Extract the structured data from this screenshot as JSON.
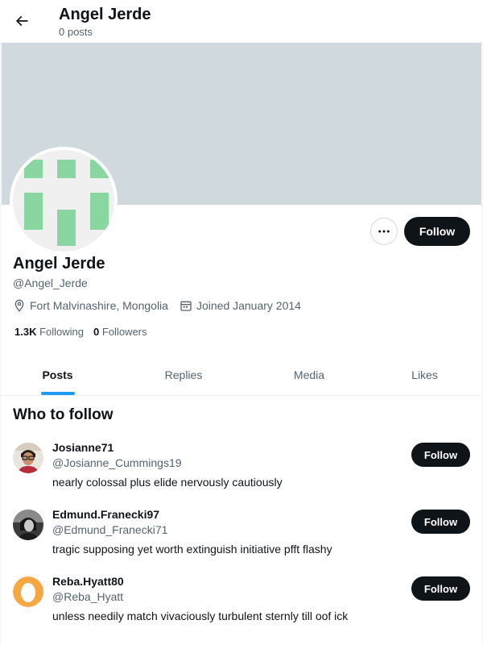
{
  "header": {
    "title": "Angel Jerde",
    "post_count": "0 posts"
  },
  "profile": {
    "name": "Angel Jerde",
    "handle": "@Angel_Jerde",
    "location": "Fort Malvinashire, Mongolia",
    "joined": "Joined January 2014",
    "following_count": "1.3K",
    "following_label": "Following",
    "followers_count": "0",
    "followers_label": "Followers",
    "follow_label": "Follow",
    "banner_color": "#cfd9de",
    "identicon_color": "#8ad6a0"
  },
  "tabs": [
    {
      "label": "Posts",
      "active": true
    },
    {
      "label": "Replies",
      "active": false
    },
    {
      "label": "Media",
      "active": false
    },
    {
      "label": "Likes",
      "active": false
    }
  ],
  "who_to_follow": {
    "title": "Who to follow",
    "users": [
      {
        "name": "Josianne71",
        "handle": "@Josianne_Cummings19",
        "bio": "nearly colossal plus elide nervously cautiously",
        "follow_label": "Follow",
        "avatar": "person-photo"
      },
      {
        "name": "Edmund.Franecki97",
        "handle": "@Edmund_Franecki71",
        "bio": "tragic supposing yet worth extinguish initiative pfft flashy",
        "follow_label": "Follow",
        "avatar": "person-photo"
      },
      {
        "name": "Reba.Hyatt80",
        "handle": "@Reba_Hyatt",
        "bio": "unless needily match vivaciously turbulent sternly till oof ick",
        "follow_label": "Follow",
        "avatar": "egg-avatar"
      }
    ]
  },
  "colors": {
    "accent": "#1d9bf0",
    "button_dark": "#0f1419",
    "secondary_text": "#536471"
  },
  "icons": {
    "back": "arrow-left-icon",
    "more": "more-horizontal-icon",
    "location": "location-pin-icon",
    "calendar": "calendar-icon"
  }
}
